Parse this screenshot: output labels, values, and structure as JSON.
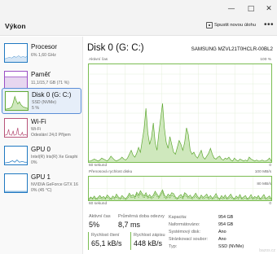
{
  "window": {
    "minimize_icon": "minimize-icon",
    "maximize_icon": "maximize-icon",
    "close_icon": "close-icon"
  },
  "header": {
    "title": "Výkon",
    "run_task_label": "Spustit novou úlohu",
    "more_label": "•••"
  },
  "sidebar": {
    "items": [
      {
        "name": "Procesor",
        "sub1": "6% 1,60 GHz",
        "sub2": "",
        "color": "#1f78c1",
        "selected": false
      },
      {
        "name": "Paměť",
        "sub1": "11,1/15,7 GB (71 %)",
        "sub2": "",
        "color": "#9b4fc4",
        "selected": false
      },
      {
        "name": "Disk 0 (G: C:)",
        "sub1": "SSD (NVMe)",
        "sub2": "5 %",
        "color": "#5fa832",
        "selected": true
      },
      {
        "name": "Wi-Fi",
        "sub1": "Wi-Fi",
        "sub2": "Odeslání 24,0 Příjem",
        "color": "#b8547a",
        "selected": false
      },
      {
        "name": "GPU 0",
        "sub1": "Intel(R) Iris(R) Xe Graphi",
        "sub2": "0%",
        "color": "#1f78c1",
        "selected": false
      },
      {
        "name": "GPU 1",
        "sub1": "NVIDIA GeForce GTX 16",
        "sub2": "0% (45 °C)",
        "color": "#1f78c1",
        "selected": false
      }
    ]
  },
  "main": {
    "title": "Disk 0 (G: C:)",
    "model": "SAMSUNG MZVL21T0HCLR-00BL2",
    "chart1": {
      "label": "Aktivní čas",
      "max_label": "100 %",
      "time_label": "60 sekund",
      "min_label": "0",
      "values": [
        1,
        1,
        2,
        3,
        2,
        1,
        2,
        4,
        3,
        2,
        1,
        3,
        6,
        4,
        2,
        1,
        2,
        3,
        5,
        3,
        2,
        4,
        8,
        12,
        7,
        5,
        9,
        15,
        10,
        22,
        34,
        55,
        30,
        18,
        25,
        40,
        20,
        12,
        30,
        45,
        60,
        35,
        20,
        14,
        26,
        18,
        10,
        8,
        15,
        22,
        18,
        12,
        20,
        35,
        28,
        12,
        8,
        10,
        6,
        4,
        8,
        12,
        5,
        3,
        6,
        9,
        14,
        8,
        4,
        3,
        5,
        6,
        3,
        2,
        4,
        3,
        5,
        2,
        1,
        4,
        2,
        1,
        3,
        2,
        1,
        2,
        1,
        5,
        3,
        2,
        1,
        2,
        1,
        1,
        2,
        1,
        1,
        2,
        4,
        1
      ]
    },
    "chart2": {
      "label": "Přenosová rychlost disku",
      "max_label": "100 MB/s",
      "sub_max_label": "80 MB/s",
      "time_label": "60 sekund",
      "min_label": "0",
      "read_values": [
        2,
        8,
        4,
        10,
        3,
        6,
        12,
        5,
        8,
        4,
        14,
        6,
        3,
        9,
        5,
        16,
        7,
        4,
        10,
        6,
        3,
        8,
        20,
        10,
        15,
        8,
        25,
        12,
        30,
        18,
        10,
        22,
        8,
        14,
        6,
        12,
        28,
        16,
        8,
        20,
        35,
        12,
        6,
        15,
        10,
        22,
        18,
        8,
        4,
        10,
        14,
        6,
        22,
        16,
        8,
        12,
        5,
        10,
        18,
        8,
        4,
        12,
        6,
        9,
        14,
        5,
        10,
        4,
        8,
        16,
        6,
        3,
        10,
        5,
        12,
        4,
        8,
        14,
        6,
        3,
        9,
        5,
        12,
        4,
        7,
        10,
        3,
        6,
        12,
        4,
        8,
        5,
        10,
        3,
        7,
        12,
        4,
        6,
        9,
        3
      ],
      "write_values": [
        5,
        14,
        8,
        18,
        6,
        12,
        20,
        10,
        16,
        8,
        22,
        14,
        6,
        18,
        10,
        26,
        14,
        8,
        20,
        12,
        6,
        16,
        30,
        18,
        24,
        14,
        34,
        22,
        40,
        28,
        18,
        32,
        14,
        24,
        12,
        22,
        38,
        26,
        14,
        30,
        44,
        22,
        12,
        26,
        18,
        32,
        28,
        14,
        8,
        18,
        24,
        12,
        32,
        26,
        14,
        22,
        10,
        18,
        30,
        16,
        8,
        22,
        12,
        18,
        26,
        10,
        20,
        8,
        16,
        28,
        12,
        6,
        20,
        10,
        22,
        8,
        16,
        26,
        12,
        6,
        18,
        10,
        24,
        8,
        14,
        20,
        6,
        12,
        24,
        8,
        16,
        10,
        20,
        6,
        14,
        24,
        8,
        12,
        18,
        6
      ]
    },
    "stats": {
      "active_time_label": "Aktivní čas",
      "active_time_value": "5%",
      "avg_response_label": "Průměrná doba odezvy",
      "avg_response_value": "8,7 ms",
      "read_speed_label": "Rychlost čtení",
      "read_speed_value": "65,1 kB/s",
      "write_speed_label": "Rychlost zápisu",
      "write_speed_value": "448 kB/s"
    },
    "properties": [
      {
        "key": "Kapacita:",
        "value": "954 GB"
      },
      {
        "key": "Naformátováno:",
        "value": "954 GB"
      },
      {
        "key": "Systémový disk:",
        "value": "Ano"
      },
      {
        "key": "Stránkovací soubor:",
        "value": "Ano"
      },
      {
        "key": "Typ:",
        "value": "SSD (NVMe)"
      }
    ],
    "accent_color": "#5fa832"
  },
  "watermark": "bazos.cz"
}
